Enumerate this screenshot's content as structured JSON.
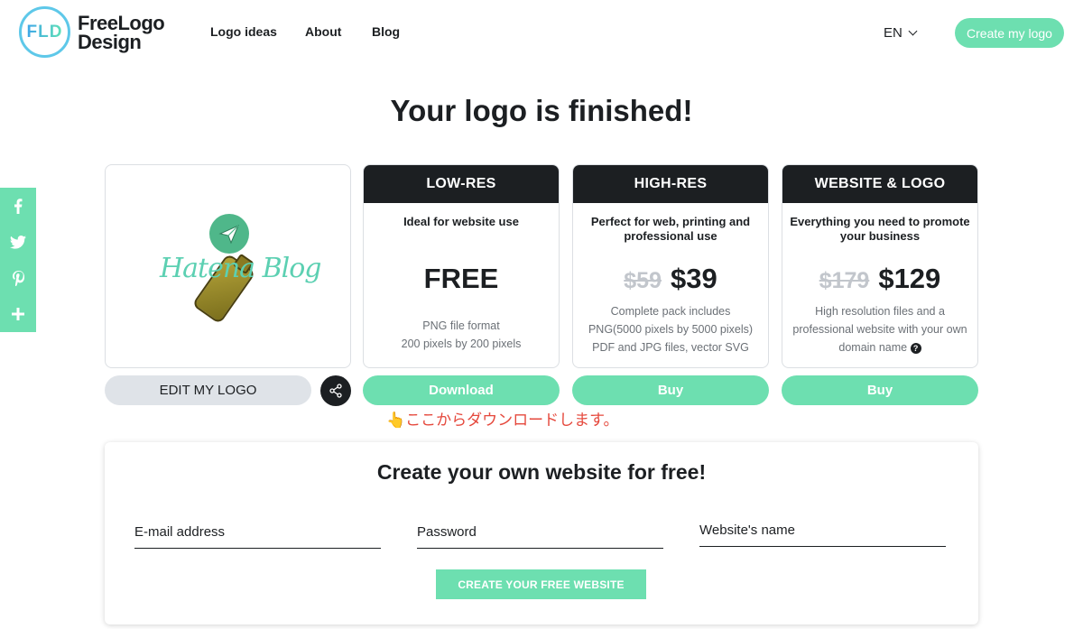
{
  "header": {
    "logo_mark": "FLD",
    "logo_line1": "FreeLogo",
    "logo_line2": "Design",
    "nav": [
      "Logo ideas",
      "About",
      "Blog"
    ],
    "language": "EN",
    "cta": "Create my logo"
  },
  "page_title": "Your logo is finished!",
  "social": [
    "f",
    "twitter-icon",
    "pinterest-icon",
    "+"
  ],
  "preview": {
    "logo_text": "Hatena Blog"
  },
  "plans": [
    {
      "name": "LOW-RES",
      "description": "Ideal for website use",
      "old_price": "",
      "price": "FREE",
      "features": [
        "PNG file format",
        "200 pixels by 200 pixels"
      ],
      "button": "Download"
    },
    {
      "name": "HIGH-RES",
      "description": "Perfect for web, printing and professional use",
      "old_price": "$59",
      "price": "$39",
      "features": [
        "Complete pack includes",
        "PNG(5000 pixels by 5000 pixels)",
        "PDF and JPG files, vector SVG"
      ],
      "button": "Buy"
    },
    {
      "name": "WEBSITE & LOGO",
      "description": "Everything you need to promote your business",
      "old_price": "$179",
      "price": "$129",
      "features": [
        "High resolution files and a",
        "professional website with your own",
        "domain name"
      ],
      "button": "Buy"
    }
  ],
  "actions": {
    "edit": "EDIT MY LOGO"
  },
  "annotation": "👆ここからダウンロードします。",
  "signup": {
    "title": "Create your own website for free!",
    "email": "E-mail address",
    "password": "Password",
    "website": "Website's name",
    "cta": "CREATE YOUR FREE WEBSITE"
  },
  "colors": {
    "accent": "#6ddfb0",
    "dark": "#1c1f22",
    "note_red": "#e5483c"
  }
}
